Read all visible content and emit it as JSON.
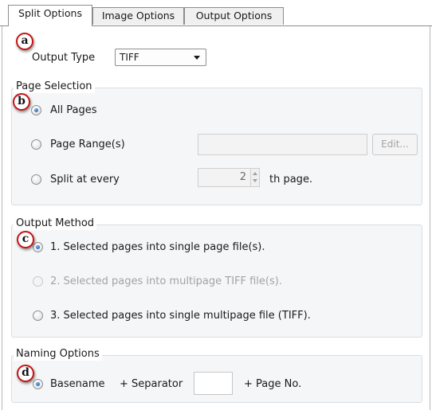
{
  "tabs": [
    {
      "label": "Split Options",
      "active": true
    },
    {
      "label": "Image Options",
      "active": false
    },
    {
      "label": "Output Options",
      "active": false
    }
  ],
  "output_type": {
    "label": "Output Type",
    "selected": "TIFF"
  },
  "page_selection": {
    "legend": "Page Selection",
    "all_pages": "All Pages",
    "page_ranges": "Page Range(s)",
    "page_ranges_value": "",
    "edit_label": "Edit...",
    "split_every": "Split at every",
    "split_value": "2",
    "split_suffix": "th page.",
    "selected": "all_pages"
  },
  "output_method": {
    "legend": "Output Method",
    "options": [
      {
        "label": "1. Selected pages into single page file(s).",
        "checked": true,
        "enabled": true
      },
      {
        "label": "2. Selected pages into multipage TIFF file(s).",
        "checked": false,
        "enabled": false
      },
      {
        "label": "3. Selected pages into single multipage file (TIFF).",
        "checked": false,
        "enabled": true
      }
    ]
  },
  "naming": {
    "legend": "Naming Options",
    "basename": "Basename",
    "separator_label": "+ Separator",
    "separator_value": "",
    "page_no_label": "+ Page No."
  },
  "markers": [
    "a",
    "b",
    "c",
    "d"
  ],
  "colors": {
    "marker_ring": "#c81414",
    "radio_dot": "#1f5fb4",
    "group_bg": "#f4f6f8"
  }
}
